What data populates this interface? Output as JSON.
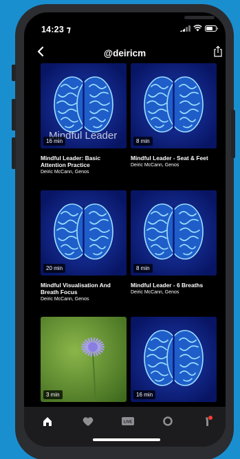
{
  "status_bar": {
    "time": "14:23 ⁊"
  },
  "header": {
    "title": "@deiricm"
  },
  "cards": [
    {
      "title": "Mindful Leader: Basic Attention Practice",
      "author": "Deiric McCann, Genos",
      "duration": "16 min",
      "overlay": "Mindful Leader",
      "image": "brain"
    },
    {
      "title": "Mindful Leader - Seat & Feet",
      "author": "Deiric McCann, Genos",
      "duration": "8 min",
      "image": "brain"
    },
    {
      "title": "Mindful Visualisation And Breath Focus",
      "author": "Deiric McCann, Genos",
      "duration": "20 min",
      "image": "brain"
    },
    {
      "title": "Mindful Leader - 6 Breaths",
      "author": "Deiric McCann, Genos",
      "duration": "8 min",
      "image": "brain"
    },
    {
      "title": "",
      "author": "",
      "duration": "3 min",
      "image": "flower"
    },
    {
      "title": "",
      "author": "",
      "duration": "16 min",
      "image": "brain"
    }
  ],
  "tab_bar": {
    "live_label": "LIVE",
    "tabs": [
      "home-icon",
      "heart-icon",
      "live-icon",
      "circle-icon",
      "profile-icon"
    ],
    "active_color": "#ffffff",
    "inactive_color": "#8e8e93"
  },
  "colors": {
    "background": "#1a8fd0",
    "screen": "#000000",
    "brain_bg": "#0a1a7a",
    "brain_line": "#7fd3ff",
    "notification_dot": "#ff3b30"
  }
}
